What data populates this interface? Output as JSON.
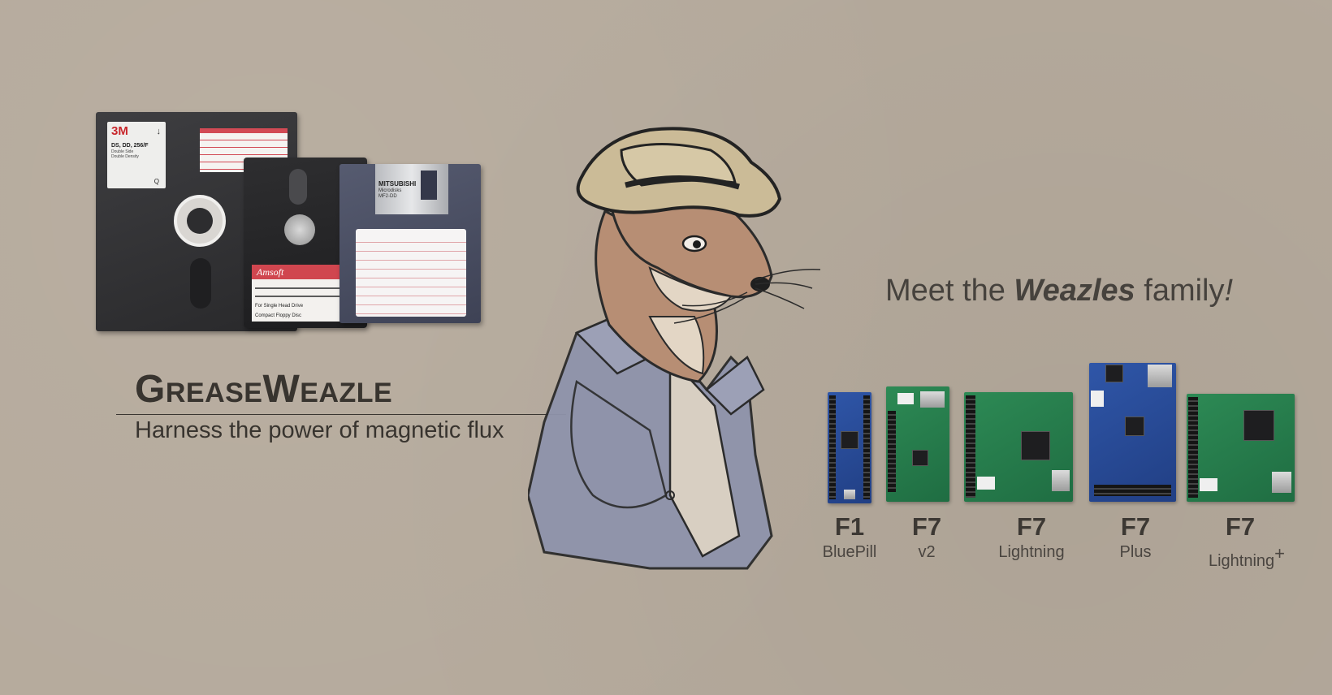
{
  "disks": {
    "disk8": {
      "label_brand": "3M",
      "label_spec": "DS, DD, 256/F",
      "label_line1": "Double Side",
      "label_line2": "Double Density",
      "label_mark": "Q"
    },
    "disk3cf": {
      "label_brand": "Amsoft",
      "label_line1": "For Single Head Drive",
      "label_line2": "Compact Floppy Disc"
    },
    "disk35": {
      "label_brand": "MITSUBISHI",
      "label_line1": "Microdisks",
      "label_line2": "MF2-DD"
    }
  },
  "brand": {
    "title": "GreaseWeazle",
    "tagline": "Harness the power of magnetic flux"
  },
  "family": {
    "heading_pre": "Meet the ",
    "heading_em": "Weazles",
    "heading_post": " family",
    "heading_bang": "!",
    "boards": [
      {
        "code": "F1",
        "name": "BluePill",
        "sup": ""
      },
      {
        "code": "F7",
        "name": "v2",
        "sup": ""
      },
      {
        "code": "F7",
        "name": "Lightning",
        "sup": ""
      },
      {
        "code": "F7",
        "name": "Plus",
        "sup": ""
      },
      {
        "code": "F7",
        "name": "Lightning",
        "sup": "+"
      }
    ]
  },
  "colors": {
    "background": "#b5aa9c",
    "text": "#3c3833",
    "pcb_green": "#2d8a55",
    "pcb_blue": "#2f56a8"
  }
}
